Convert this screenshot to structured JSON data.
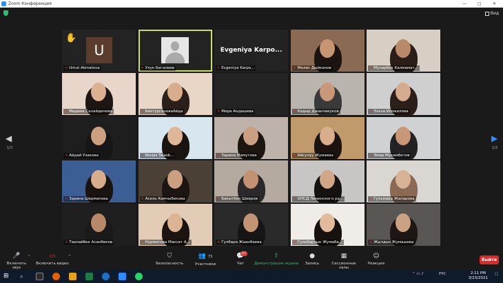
{
  "window": {
    "title": "Zoom Конференция",
    "minimize": "—",
    "maximize": "□",
    "close": "✕"
  },
  "topbar": {
    "view_label": "Вид"
  },
  "page": {
    "left_indicator": "1/3",
    "right_indicator": "1/3"
  },
  "participants": [
    {
      "name": "Umut Akmatova",
      "type": "avatar",
      "avatar_letter": "U",
      "hand_raised": true
    },
    {
      "name": "Улук Бегалиев",
      "type": "generic",
      "active": true
    },
    {
      "name": "Evgeniya Karpo...",
      "type": "nameonly",
      "display": "Evgeniya  Karpo..."
    },
    {
      "name": "Мелис Дыйканов",
      "type": "video",
      "bg": "#8a6a52",
      "skin": "#c69572",
      "hair": "#1c1410"
    },
    {
      "name": "Мунарбек Калмамат...",
      "type": "video",
      "bg": "#d8cfc4",
      "skin": "#b98a6a",
      "hair": "#2a1e18"
    },
    {
      "name": "Мадина Салайдинова",
      "type": "video",
      "bg": "#e7d6c9",
      "skin": "#dcb191",
      "hair": "#1d1612"
    },
    {
      "name": "БектургановаАйда",
      "type": "video",
      "bg": "#e8d6c6",
      "skin": "#d8ad8c",
      "hair": "#2b1f19"
    },
    {
      "name": "Мира Андашева",
      "type": "empty"
    },
    {
      "name": "Кадыр Джанчакуков",
      "type": "video",
      "bg": "#b9b4ae",
      "skin": "#c99879",
      "hair": "#3a3a3a"
    },
    {
      "name": "Эльза Исмаилова",
      "type": "video",
      "bg": "#cfcfcf",
      "skin": "#d4ab8f",
      "hair": "#2a1f1a"
    },
    {
      "name": "Айдай Узакова",
      "type": "video",
      "bg": "#1e1e1e",
      "skin": "#caa080",
      "hair": "#161616"
    },
    {
      "name": "Nurjaz Talasb...",
      "type": "video",
      "bg": "#d7e6ef",
      "skin": "#e0b796",
      "hair": "#1a1410"
    },
    {
      "name": "Зарина Мамутова",
      "type": "video",
      "bg": "#bdb3aa",
      "skin": "#caa080",
      "hair": "#1c1510"
    },
    {
      "name": "Айсулуу Жумаева",
      "type": "video",
      "bg": "#c09a6a",
      "skin": "#d9ae8c",
      "hair": "#1a1310"
    },
    {
      "name": "Эмир Мукамбетов",
      "type": "video",
      "bg": "#cfd1d2",
      "skin": "#c79777",
      "hair": "#222"
    },
    {
      "name": "Зарина Шермапова",
      "type": "video",
      "bg": "#3b5e95",
      "skin": "#d8ad8c",
      "hair": "#1a1410"
    },
    {
      "name": "Асель Камчыбекова",
      "type": "video",
      "bg": "#4a4036",
      "skin": "#caa080",
      "hair": "#1c1612"
    },
    {
      "name": "Бакытбек Шиеров",
      "type": "video",
      "bg": "#b4aaa0",
      "skin": "#c39272",
      "hair": "#2a2a2a"
    },
    {
      "name": "ОПСД Ленинского ра...",
      "type": "video",
      "bg": "#c8c6c4",
      "skin": "#d2a786",
      "hair": "#161210"
    },
    {
      "name": "Гульмира Жапарова",
      "type": "video",
      "bg": "#dad6d1",
      "skin": "#d8b296",
      "hair": "#8a6a54"
    },
    {
      "name": "Таалайбек Асанбеков",
      "type": "video",
      "bg": "#1f1f1f",
      "skin": "#b88968",
      "hair": "#1a1a1a"
    },
    {
      "name": "Нурматова Максат А...",
      "type": "video",
      "bg": "#e3ccb6",
      "skin": "#dcb393",
      "hair": "#1b1411"
    },
    {
      "name": "Гулбара Жаанбаева",
      "type": "video",
      "bg": "#2a2a2a",
      "skin": "#c29473",
      "hair": "#161616"
    },
    {
      "name": "Гульбарчын Жумаба...",
      "type": "video",
      "bg": "#f0ede8",
      "skin": "#e2bb9d",
      "hair": "#171210"
    },
    {
      "name": "Жылдыз Жумашева",
      "type": "video",
      "bg": "#5a5654",
      "skin": "#caa283",
      "hair": "#1d1714"
    }
  ],
  "toolbar": {
    "unmute": "Включить звук",
    "start_video": "Включить видео",
    "security": "Безопасность",
    "participants": "Участники",
    "participants_count": "73",
    "chat": "Чат",
    "chat_badge": "51",
    "share_screen": "Демонстрация экрана",
    "record": "Запись",
    "breakout": "Сессионные залы",
    "reactions": "Реакции",
    "leave": "Выйти"
  },
  "taskbar": {
    "lang": "РУС",
    "time": "2:11 PM",
    "date": "3/23/2021"
  },
  "colors": {
    "active_border": "#c9e265",
    "share_green": "#25c06b",
    "leave_red": "#e02828",
    "muted_red": "#e53935"
  }
}
